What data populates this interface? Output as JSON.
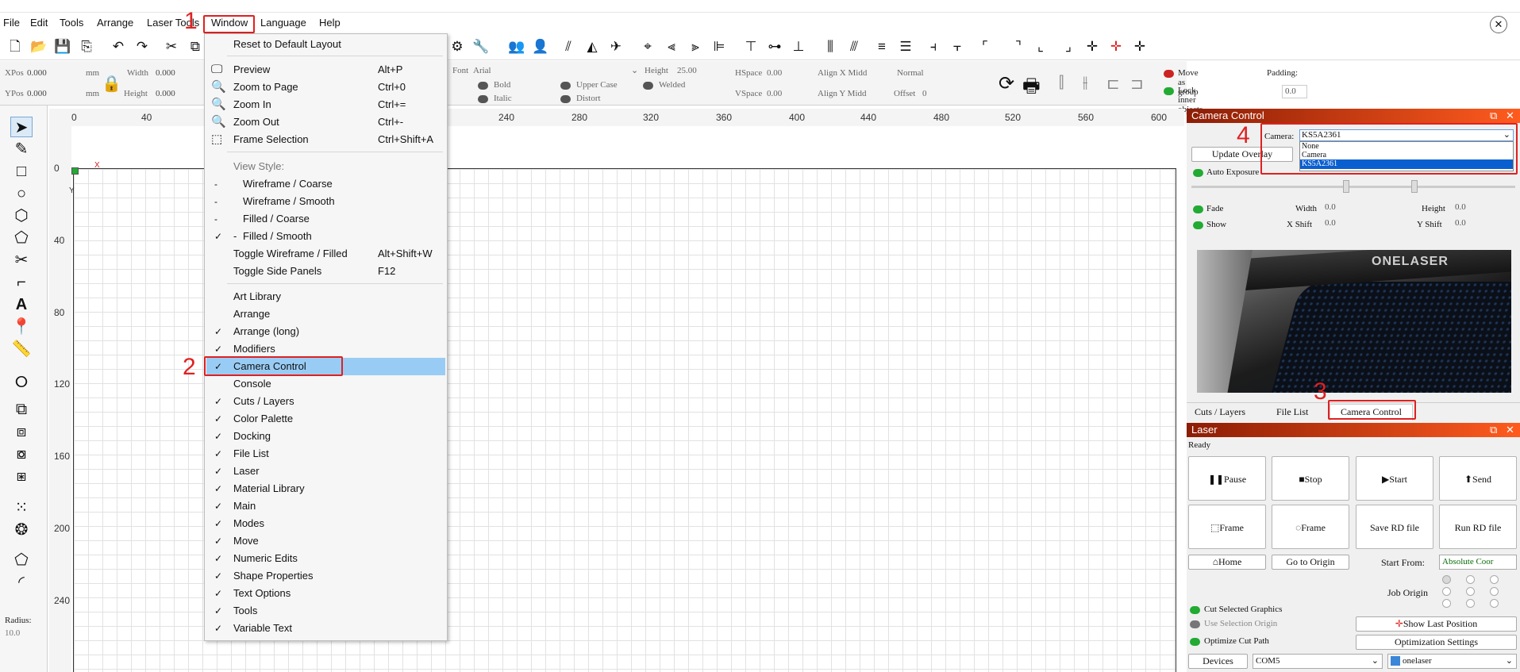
{
  "menubar": {
    "items": [
      "File",
      "Edit",
      "Tools",
      "Arrange",
      "Laser Tools",
      "Window",
      "Language",
      "Help"
    ]
  },
  "annotations": [
    "1",
    "2",
    "3",
    "4"
  ],
  "toolbar2": {
    "xpos_label": "XPos",
    "xpos_value": "0.000",
    "ypos_label": "YPos",
    "ypos_value": "0.000",
    "unit": "mm",
    "width_label": "Width",
    "width_value": "0.000",
    "height_label": "Height",
    "height_value": "0.000",
    "font_label": "Font",
    "font_value": "Arial",
    "text_height_label": "Height",
    "text_height_value": "25.00",
    "bold": "Bold",
    "italic": "Italic",
    "upper_case": "Upper Case",
    "distort": "Distort",
    "welded": "Welded",
    "hspace_label": "HSpace",
    "hspace_value": "0.00",
    "vspace_label": "VSpace",
    "vspace_value": "0.00",
    "align_x": "Align X Midd",
    "align_y": "Align Y Midd",
    "normal": "Normal",
    "offset_label": "Offset",
    "offset_value": "0",
    "move_as_group": "Move as group",
    "lock_inner": "Lock inner objects",
    "padding_label": "Padding:",
    "padding_value": "0.0"
  },
  "ruler_top": [
    "0",
    "40",
    "240",
    "280",
    "320",
    "360",
    "400",
    "440",
    "480",
    "520",
    "560",
    "600"
  ],
  "ruler_left": [
    "0",
    "40",
    "80",
    "120",
    "160",
    "200",
    "240"
  ],
  "canvas": {
    "x_label": "X",
    "y_label": "Y"
  },
  "left_tools": {
    "radius_label": "Radius:",
    "radius_value": "10.0"
  },
  "window_menu": {
    "reset": "Reset to Default Layout",
    "preview": "Preview",
    "preview_key": "Alt+P",
    "zoom_page": "Zoom to Page",
    "zoom_page_key": "Ctrl+0",
    "zoom_in": "Zoom In",
    "zoom_in_key": "Ctrl+=",
    "zoom_out": "Zoom Out",
    "zoom_out_key": "Ctrl+-",
    "frame_sel": "Frame Selection",
    "frame_sel_key": "Ctrl+Shift+A",
    "view_style": "View Style:",
    "wire_coarse": "Wireframe / Coarse",
    "wire_smooth": "Wireframe / Smooth",
    "filled_coarse": "Filled / Coarse",
    "filled_smooth": "Filled / Smooth",
    "toggle_wf": "Toggle Wireframe / Filled",
    "toggle_wf_key": "Alt+Shift+W",
    "toggle_side": "Toggle Side Panels",
    "toggle_side_key": "F12",
    "panels": [
      "Art Library",
      "Arrange",
      "Arrange (long)",
      "Modifiers",
      "Camera Control",
      "Console",
      "Cuts / Layers",
      "Color Palette",
      "Docking",
      "File List",
      "Laser",
      "Material Library",
      "Main",
      "Modes",
      "Move",
      "Numeric Edits",
      "Shape Properties",
      "Text Options",
      "Tools",
      "Variable Text"
    ]
  },
  "camera_panel": {
    "title": "Camera Control",
    "camera_label": "Camera:",
    "camera_value": "KS5A2361",
    "dropdown_options": [
      "None",
      "Camera",
      "KS5A2361"
    ],
    "update_overlay": "Update Overlay",
    "auto_exposure": "Auto Exposure",
    "fade": "Fade",
    "show": "Show",
    "width_label": "Width",
    "width_value": "0.0",
    "height_label": "Height",
    "height_value": "0.0",
    "xshift_label": "X Shift",
    "xshift_value": "0.0",
    "yshift_label": "Y Shift",
    "yshift_value": "0.0",
    "brand_logo": "ONELASER"
  },
  "tabs": [
    "Cuts / Layers",
    "File List",
    "Camera Control"
  ],
  "laser_panel": {
    "title": "Laser",
    "status": "Ready",
    "pause": "Pause",
    "stop": "Stop",
    "start": "Start",
    "send": "Send",
    "frame1": "Frame",
    "frame2": "Frame",
    "save_rd": "Save RD file",
    "run_rd": "Run RD file",
    "home": "Home",
    "go_origin": "Go to Origin",
    "start_from_label": "Start From:",
    "start_from_value": "Absolute Coor",
    "job_origin": "Job Origin",
    "cut_selected": "Cut Selected Graphics",
    "use_selection_origin": "Use Selection Origin",
    "show_last_position": "Show Last Position",
    "optimize_cut_path": "Optimize Cut Path",
    "optimization_settings": "Optimization Settings",
    "devices": "Devices",
    "port": "COM5",
    "device_name": "onelaser"
  },
  "colors": {
    "accent_red": "#e02020",
    "highlight": "#99ccf5",
    "title_gradient_start": "#8c1d05",
    "title_gradient_end": "#ff5b1e",
    "toggle_on": "#22aa33"
  }
}
